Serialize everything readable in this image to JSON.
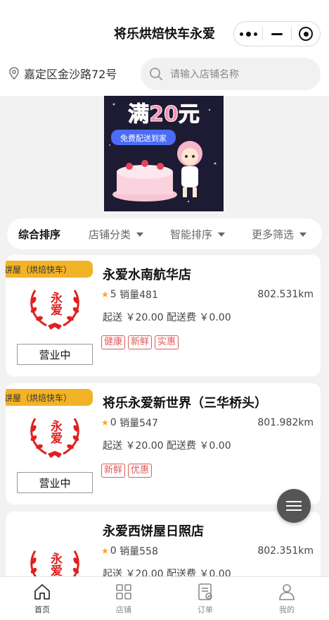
{
  "header": {
    "title": "将乐烘焙快车永爱"
  },
  "location": {
    "address": "嘉定区金沙路72号"
  },
  "search": {
    "placeholder": "请输入店铺名称"
  },
  "banner": {
    "headline": "满20元",
    "subline": "免费配送到家"
  },
  "filters": [
    {
      "label": "综合排序",
      "active": true
    },
    {
      "label": "店铺分类",
      "active": false
    },
    {
      "label": "智能排序",
      "active": false
    },
    {
      "label": "更多筛选",
      "active": false
    }
  ],
  "stores": [
    {
      "ribbon": "西饼屋（烘焙快车）",
      "logo_text": "永爱",
      "status": "营业中",
      "name": "永爱水南航华店",
      "rating": "5",
      "sales": "销量481",
      "distance": "802.531km",
      "fee": "起送 ￥20.00 配送费 ￥0.00",
      "tags": [
        "健康",
        "新鲜",
        "实惠"
      ]
    },
    {
      "ribbon": "西饼屋（烘焙快车）",
      "logo_text": "永爱",
      "status": "营业中",
      "name": "将乐永爱新世界（三华桥头）",
      "rating": "0",
      "sales": "销量547",
      "distance": "801.982km",
      "fee": "起送 ￥20.00 配送费 ￥0.00",
      "tags": [
        "新鲜",
        "优惠"
      ]
    },
    {
      "ribbon": "",
      "logo_text": "永爱",
      "status": "",
      "name": "永爱西饼屋日照店",
      "rating": "0",
      "sales": "销量558",
      "distance": "802.351km",
      "fee": "起送 ￥20.00 配送费 ￥0.00",
      "tags": []
    }
  ],
  "tabbar": [
    {
      "label": "首页",
      "icon": "home-icon",
      "active": true
    },
    {
      "label": "店铺",
      "icon": "grid-icon",
      "active": false
    },
    {
      "label": "订单",
      "icon": "order-icon",
      "active": false
    },
    {
      "label": "我的",
      "icon": "user-icon",
      "active": false
    }
  ],
  "colors": {
    "accent": "#f2b326",
    "tag": "#e05a5a",
    "logo_red": "#e02020"
  }
}
